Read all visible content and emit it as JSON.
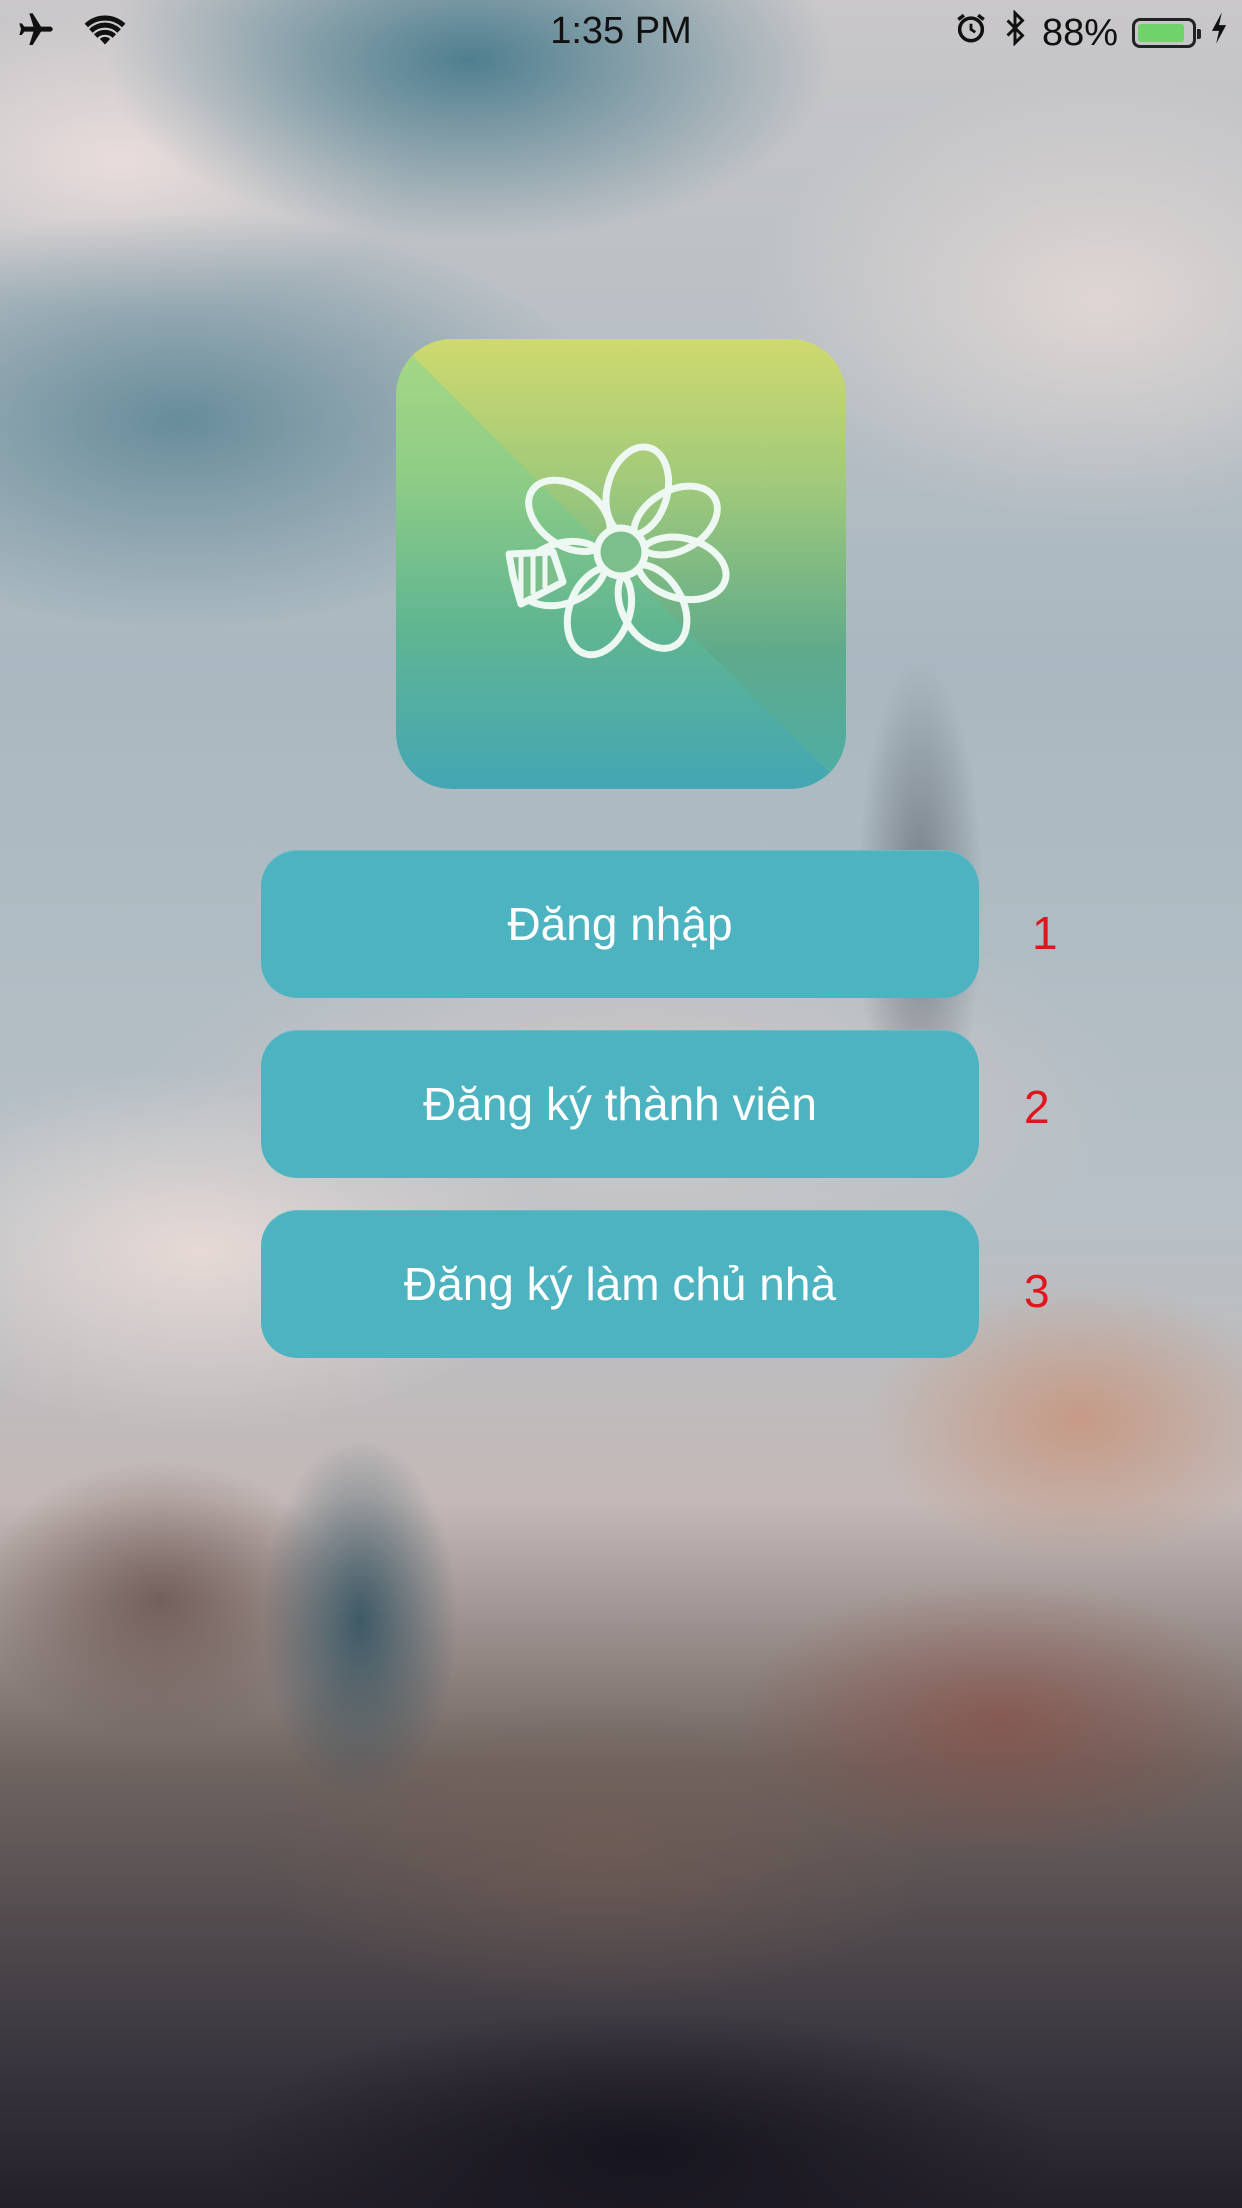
{
  "status_bar": {
    "time": "1:35 PM",
    "battery_percent": "88%",
    "battery_level": 0.88,
    "icons": [
      "airplane-icon",
      "wifi-icon",
      "alarm-icon",
      "bluetooth-icon",
      "battery-icon",
      "charging-icon"
    ]
  },
  "logo": {
    "icon": "flower-icon",
    "colors": [
      "#a7d885",
      "#d6da6a",
      "#43a6b4"
    ]
  },
  "buttons": [
    {
      "label": "Đăng nhập",
      "annotation": "1"
    },
    {
      "label": "Đăng ký thành viên",
      "annotation": "2"
    },
    {
      "label": "Đăng ký làm chủ nhà",
      "annotation": "3"
    }
  ],
  "colors": {
    "button": "#4db3c1",
    "button_text": "#ffffff",
    "annotation": "#e0161e"
  }
}
